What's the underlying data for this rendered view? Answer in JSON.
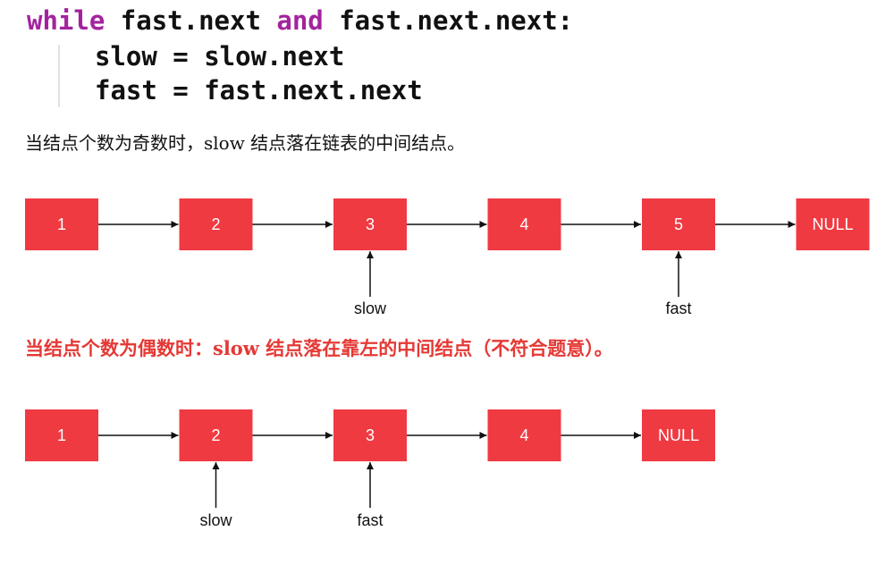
{
  "code": {
    "line1": {
      "kw1": "while",
      "part1": " fast.next ",
      "kw2": "and",
      "part2": " fast.next.next:"
    },
    "line2": "slow = slow.next",
    "line3": "fast = fast.next.next",
    "keyword_color": "#a3239e"
  },
  "captions": {
    "odd": "当结点个数为奇数时，slow 结点落在链表的中间结点。",
    "even": "当结点个数为偶数时：slow 结点落在靠左的中间结点（不符合题意）。",
    "even_color": "#e53935"
  },
  "node_color": "#f03a42",
  "lists": [
    {
      "nodes": [
        "1",
        "2",
        "3",
        "4",
        "5",
        "NULL"
      ],
      "pointers": [
        {
          "label": "slow",
          "node_index": 2
        },
        {
          "label": "fast",
          "node_index": 4
        }
      ]
    },
    {
      "nodes": [
        "1",
        "2",
        "3",
        "4",
        "NULL"
      ],
      "pointers": [
        {
          "label": "slow",
          "node_index": 1
        },
        {
          "label": "fast",
          "node_index": 2
        }
      ]
    }
  ]
}
